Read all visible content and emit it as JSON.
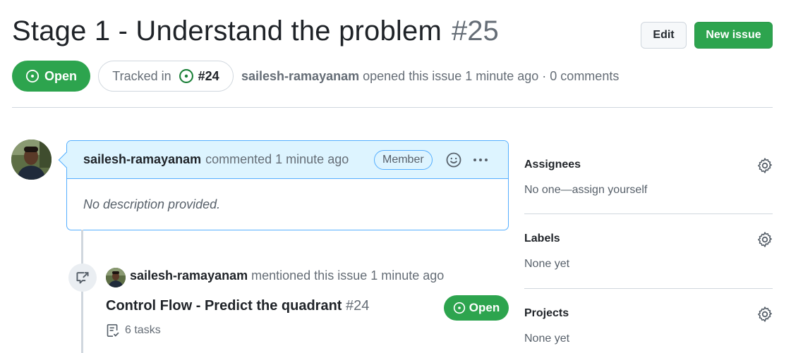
{
  "issue": {
    "title": "Stage 1 - Understand the problem",
    "number": "#25",
    "state": "Open",
    "tracked_label": "Tracked in",
    "tracked_number": "#24",
    "author": "sailesh-ramayanam",
    "opened_text": "opened this issue 1 minute ago · 0 comments"
  },
  "header_actions": {
    "edit_label": "Edit",
    "new_issue_label": "New issue"
  },
  "comment": {
    "author": "sailesh-ramayanam",
    "action_text": "commented 1 minute ago",
    "badge": "Member",
    "body": "No description provided."
  },
  "event": {
    "author": "sailesh-ramayanam",
    "action_text": "mentioned this issue 1 minute ago",
    "ref_title": "Control Flow - Predict the quadrant",
    "ref_number": "#24",
    "ref_state": "Open",
    "tasks": "6 tasks"
  },
  "sidebar": {
    "sections": [
      {
        "heading": "Assignees",
        "value": "No one—assign yourself"
      },
      {
        "heading": "Labels",
        "value": "None yet"
      },
      {
        "heading": "Projects",
        "value": "None yet"
      }
    ]
  },
  "colors": {
    "open_green": "#2da44e",
    "accent_blue_border": "#54aeff",
    "header_blue_bg": "#ddf4ff"
  }
}
